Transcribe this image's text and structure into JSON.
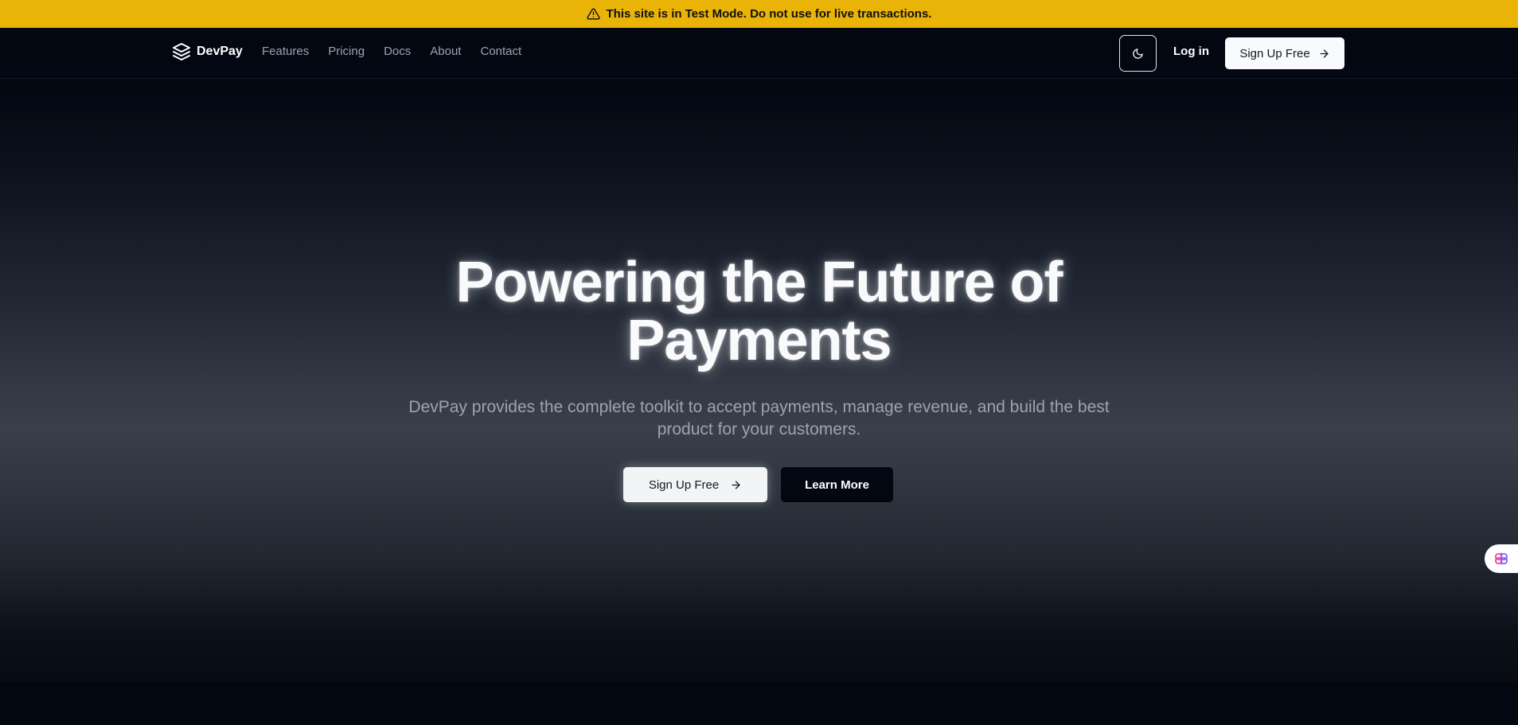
{
  "banner": {
    "text": "This site is in Test Mode. Do not use for live transactions.",
    "icon": "warning-triangle-icon",
    "color": "#eab308"
  },
  "nav": {
    "brand": "DevPay",
    "links": [
      "Features",
      "Pricing",
      "Docs",
      "About",
      "Contact"
    ],
    "theme_icon": "moon-icon",
    "login": "Log in",
    "signup": "Sign Up Free"
  },
  "hero": {
    "title_line1": "Powering the Future of",
    "title_line2": "Payments",
    "subtitle": "DevPay provides the complete toolkit to accept payments, manage revenue, and build the best product for your customers.",
    "primary_cta": "Sign Up Free",
    "secondary_cta": "Learn More"
  },
  "colors": {
    "background": "#030712",
    "accent": "#eab308"
  }
}
